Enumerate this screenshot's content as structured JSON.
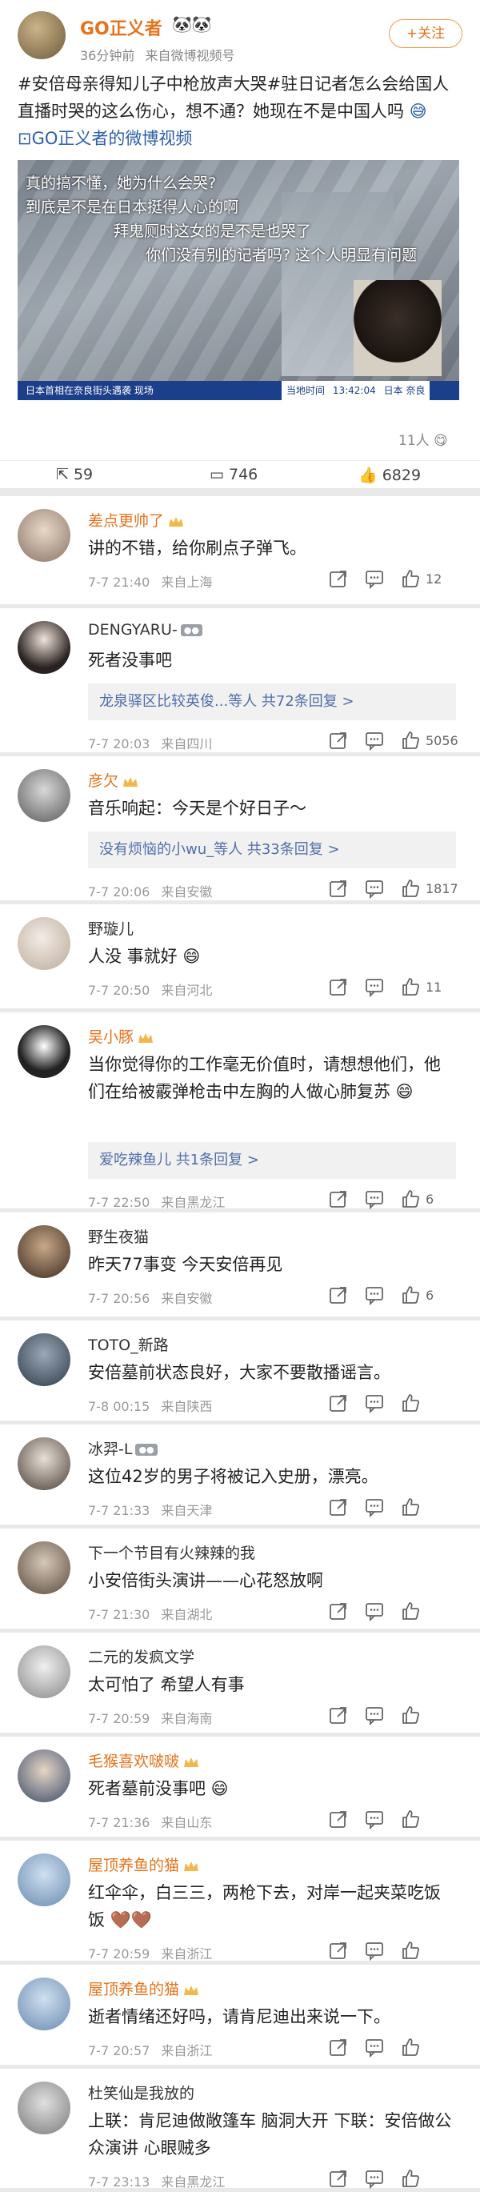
{
  "post": {
    "author": "GO正义者",
    "time": "36分钟前",
    "source": "来自微博视频号",
    "follow_label": "+关注",
    "text": "#安倍母亲得知儿子中枪放声大哭#驻日记者怎么会给国人直播时哭的这么伤心，想不通？她现在不是中国人吗",
    "video_link": "GO正义者的微博视频",
    "video_overlay_lines": [
      "真的搞不懂，她为什么会哭?",
      "到底是不是在日本挺得人心的啊",
      "拜鬼厕时这女的是不是也哭了",
      "你们没有别的记者吗? 这个人明显有问题"
    ],
    "video_ticker": [
      "日本首相在奈良街头遇袭 现场",
      "当地时间",
      "13:42:04",
      "日本 奈良"
    ],
    "viewers": "11人",
    "actions": {
      "repost": "59",
      "comment": "746",
      "like": "6829"
    }
  },
  "comments": [
    {
      "name": "差点更帅了",
      "text": "讲的不错，给你刷点子弹飞。",
      "time": "7-7 21:40",
      "loc": "来自上海",
      "likes": "12"
    },
    {
      "name": "DENGYARU-",
      "text": "死者没事吧",
      "time": "7-7 20:03",
      "loc": "来自四川",
      "likes": "5056",
      "reply": "龙泉驿区比较英俊...等人  共72条回复 >"
    },
    {
      "name": "彦欠",
      "text": "音乐响起：今天是个好日子～",
      "time": "7-7 20:06",
      "loc": "来自安徽",
      "likes": "1817",
      "reply": "没有烦恼的小wu_等人  共33条回复 >"
    },
    {
      "name": "野璇儿",
      "text": "人没 事就好",
      "time": "7-7 20:50",
      "loc": "来自河北",
      "likes": "11"
    },
    {
      "name": "吴小豚",
      "text": "当你觉得你的工作毫无价值时，请想想他们，他们在给被霰弹枪击中左胸的人做心肺复苏",
      "time": "7-7 22:50",
      "loc": "来自黑龙江",
      "likes": "6",
      "reply": "爱吃辣鱼儿  共1条回复 >"
    },
    {
      "name": "野生夜猫",
      "text": "昨天77事变 今天安倍再见",
      "time": "7-7 20:56",
      "loc": "来自安徽",
      "likes": "6"
    },
    {
      "name": "TOTO_新路",
      "text": "安倍墓前状态良好，大家不要散播谣言。",
      "time": "7-8 00:15",
      "loc": "来自陕西",
      "likes": ""
    },
    {
      "name": "冰羿-L",
      "text": "这位42岁的男子将被记入史册，漂亮。",
      "time": "7-7 21:33",
      "loc": "来自天津",
      "likes": ""
    },
    {
      "name": "下一个节目有火辣辣的我",
      "text": "小安倍街头演讲——心花怒放啊",
      "time": "7-7 21:30",
      "loc": "来自湖北",
      "likes": ""
    },
    {
      "name": "二元的发疯文学",
      "text": "太可怕了 希望人有事",
      "time": "7-7 20:59",
      "loc": "来自海南",
      "likes": ""
    },
    {
      "name": "毛猴喜欢啵啵",
      "text": "死者墓前没事吧",
      "time": "7-7 21:36",
      "loc": "来自山东",
      "likes": ""
    },
    {
      "name": "屋顶养鱼的猫",
      "text": "红伞伞，白三三，两枪下去，对岸一起夹菜吃饭饭",
      "time": "7-7 20:59",
      "loc": "来自浙江",
      "likes": ""
    },
    {
      "name": "屋顶养鱼的猫",
      "text": "逝者情绪还好吗，请肯尼迪出来说一下。",
      "time": "7-7 20:57",
      "loc": "来自浙江",
      "likes": ""
    },
    {
      "name": "杜笑仙是我放的",
      "text": "上联：肯尼迪做敞篷车 脑洞大开 下联：安倍做公众演讲 心眼贼多",
      "time": "7-7 23:13",
      "loc": "来自黑龙江",
      "likes": ""
    }
  ],
  "colors": {
    "accent": "#e6731c",
    "link": "#4f6ea8",
    "muted": "#999999"
  }
}
